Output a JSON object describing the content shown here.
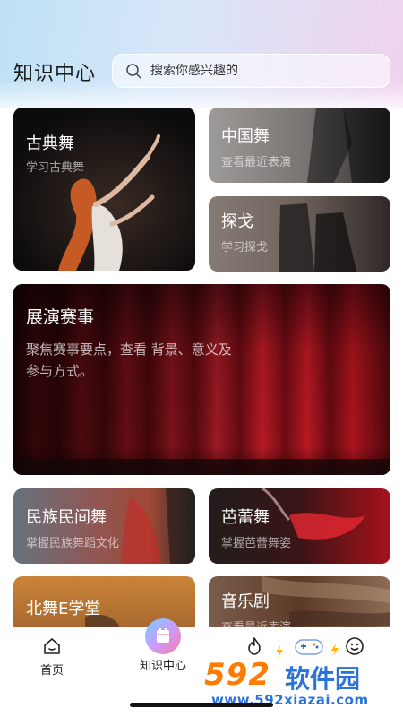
{
  "header": {
    "title": "知识中心",
    "search_placeholder": "搜索你感兴趣的"
  },
  "cards": [
    {
      "title": "古典舞",
      "subtitle": "学习古典舞"
    },
    {
      "title": "中国舞",
      "subtitle": "查看最近表演"
    },
    {
      "title": "探戈",
      "subtitle": "学习探戈"
    },
    {
      "title": "展演赛事",
      "subtitle_line1": "聚焦赛事要点，查看 背景、意义及",
      "subtitle_line2": "参与方式。"
    },
    {
      "title": "民族民间舞",
      "subtitle": "掌握民族舞蹈文化"
    },
    {
      "title": "芭蕾舞",
      "subtitle": "掌握芭蕾舞姿"
    },
    {
      "title": "北舞E学堂",
      "subtitle": ""
    },
    {
      "title": "音乐剧",
      "subtitle": "查看最近表演"
    }
  ],
  "tabbar": {
    "tabs": [
      {
        "label": "首页",
        "icon": "home-icon"
      },
      {
        "label": "知识中心",
        "icon": "book-icon"
      },
      {
        "label": "",
        "icon": "flame-icon"
      },
      {
        "label": "",
        "icon": "smile-icon"
      }
    ]
  },
  "watermark": {
    "brand": "592",
    "brand_cn": "软件园",
    "url": "www.592xiazai.com"
  },
  "colors": {
    "accent_orange": "#ff7a00",
    "accent_blue": "#2a73d8",
    "curtain_red": "#a8121e"
  }
}
